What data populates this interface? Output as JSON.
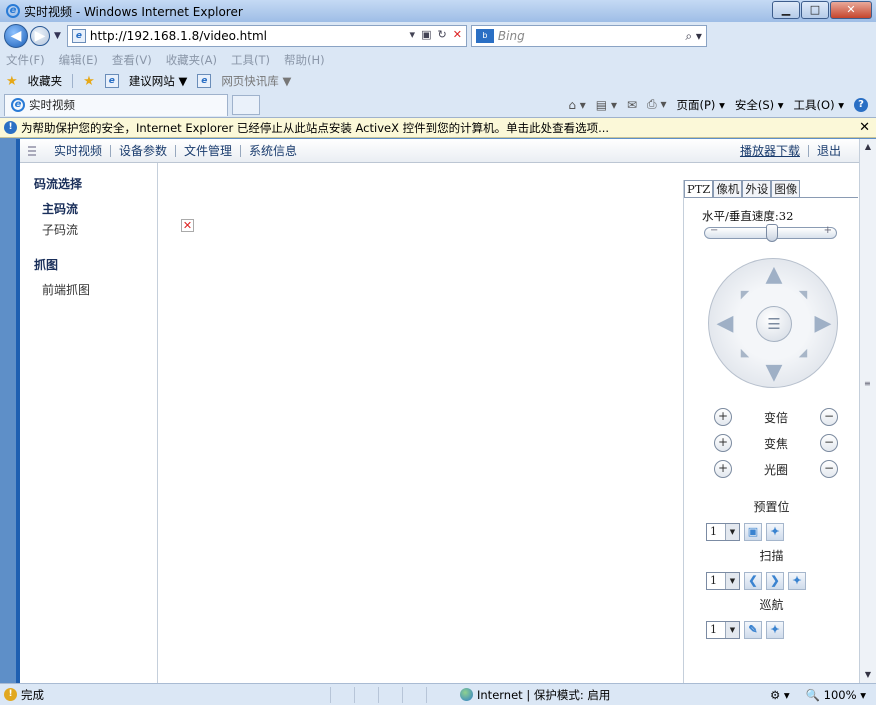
{
  "window": {
    "title": "实时视频 - Windows Internet Explorer"
  },
  "address": {
    "url": "http://192.168.1.8/video.html",
    "search_placeholder": "Bing"
  },
  "menu": [
    "文件(F)",
    "编辑(E)",
    "查看(V)",
    "收藏夹(A)",
    "工具(T)",
    "帮助(H)"
  ],
  "favorites": {
    "label": "收藏夹",
    "items": [
      "建议网站 ▼",
      "网页快讯库 ▼"
    ]
  },
  "tab": {
    "title": "实时视频"
  },
  "commands": {
    "page": "页面(P) ▾",
    "safety": "安全(S) ▾",
    "tools": "工具(O) ▾"
  },
  "infobar": {
    "text": "为帮助保护您的安全，Internet Explorer 已经停止从此站点安装 ActiveX 控件到您的计算机。单击此处查看选项..."
  },
  "topnav": {
    "items": [
      "实时视频",
      "设备参数",
      "文件管理",
      "系统信息"
    ],
    "right": [
      "播放器下载",
      "退出"
    ]
  },
  "leftpane": {
    "stream_head": "码流选择",
    "streams": [
      "主码流",
      "子码流"
    ],
    "capture_head": "抓图",
    "captures": [
      "前端抓图"
    ]
  },
  "ptz": {
    "tabs": [
      "PTZ",
      "像机",
      "外设",
      "图像"
    ],
    "speed_label": "水平/垂直速度:",
    "speed_value": "32",
    "speed_fraction": 0.5,
    "zoom_labels": [
      "变倍",
      "变焦",
      "光圈"
    ],
    "preset_label": "预置位",
    "preset_value": "1",
    "scan_label": "扫描",
    "scan_value": "1",
    "cruise_label": "巡航",
    "cruise_value": "1"
  },
  "status": {
    "left": "完成",
    "zone": "Internet | 保护模式: 启用",
    "zoom": "100%"
  }
}
